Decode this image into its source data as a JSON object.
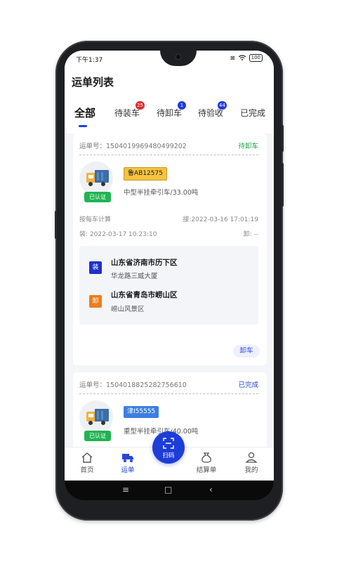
{
  "status_bar": {
    "time": "下午1:37",
    "battery": "100"
  },
  "page_title": "运单列表",
  "tabs": [
    {
      "label": "全部",
      "badge": ""
    },
    {
      "label": "待装车",
      "badge": "25",
      "badge_color": "#e02b2b"
    },
    {
      "label": "待卸车",
      "badge": "1",
      "badge_color": "#1f3bd8"
    },
    {
      "label": "待验收",
      "badge": "44",
      "badge_color": "#1f3bd8"
    },
    {
      "label": "已完成",
      "badge": ""
    }
  ],
  "orders": [
    {
      "order_no": "运单号：1504019969480499202",
      "status": "待卸车",
      "status_color": "#1ba64a",
      "verified": "已认证",
      "plate": "鲁AB12575",
      "plate_bg": "#f5c242",
      "vehicle": "中型半挂牵引车/33.00吨",
      "billing": "按每车计算",
      "accept_time": "接:2022-03-16 17:01:19",
      "load_time": "装: 2022-03-17 10:23:10",
      "unload_time": "卸: --",
      "from_tag": "装",
      "from_city": "山东省济南市历下区",
      "from_addr": "华龙路三威大厦",
      "to_tag": "卸",
      "to_city": "山东省青岛市崂山区",
      "to_addr": "崂山风景区",
      "action": "卸车"
    },
    {
      "order_no": "运单号：1504018825282756610",
      "status": "已完成",
      "status_color": "#2545d6",
      "verified": "已认证",
      "plate": "津I55555",
      "plate_bg": "#3c7fe0",
      "vehicle": "重型半挂牵引车/40.00吨"
    }
  ],
  "bottom_nav": {
    "home": "首页",
    "waybill": "运单",
    "scan": "扫码",
    "settlement": "结算单",
    "mine": "我的"
  }
}
